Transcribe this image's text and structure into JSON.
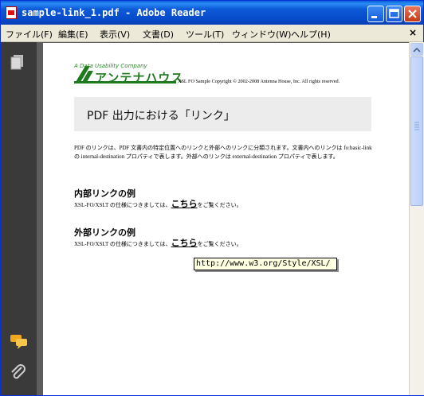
{
  "window": {
    "title": "sample-link_1.pdf - Adobe Reader"
  },
  "menu": {
    "items": [
      "ファイル(F)",
      "編集(E)",
      "表示(V)",
      "文書(D)",
      "ツール(T)",
      "ウィンドウ(W)",
      "ヘルプ(H)"
    ],
    "close_glyph": "×"
  },
  "sidebar": {
    "icons": [
      "pages-icon",
      "comments-icon",
      "attachments-icon"
    ]
  },
  "document": {
    "logo_tagline": "A Data Usability Company",
    "logo_name": "アンテナハウス",
    "copyright": "XSL FO Sample Copyright © 2002-2008 Antenna House, Inc. All rights reserved.",
    "title": "PDF 出力における「リンク」",
    "intro": "PDF のリンクは、PDF 文書内の特定位置へのリンクと外部へのリンクに分類されます。文書内へのリンクは fo:basic-link の internal-destination プロパティで表します。外部へのリンクは external-destination プロパティで表します。",
    "internal": {
      "heading": "内部リンクの例",
      "text_before": "XSL-FO/XSLT の仕様につきましては、",
      "link": "こちら",
      "text_after": "をご覧ください。"
    },
    "external": {
      "heading": "外部リンクの例",
      "text_before": "XSL-FO/XSLT の仕様につきましては、",
      "link": "こちら",
      "text_after": "をご覧ください。"
    },
    "tooltip": "http://www.w3.org/Style/XSL/"
  },
  "colors": {
    "titlebar": "#0a52d4",
    "logo_green": "#1f7a1f",
    "tooltip_bg": "#ffffe1"
  }
}
